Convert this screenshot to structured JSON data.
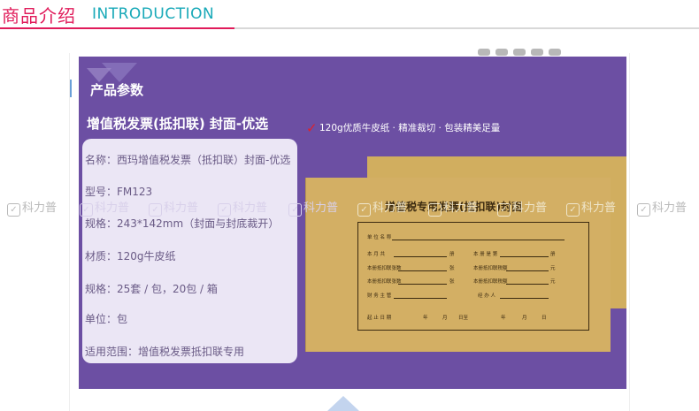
{
  "header": {
    "title_cn": "商品介绍",
    "title_en": "INTRODUCTION"
  },
  "panel": {
    "section_label": "产品参数",
    "title": "增值税发票(抵扣联) 封面-优选",
    "features": "120g优质牛皮纸 · 精准裁切 · 包装精美足量"
  },
  "specs": [
    "名称：西玛增值税发票（抵扣联）封面-优选",
    "型号：FM123",
    "规格：243*142mm（封面与封底裁开）",
    "材质：120g牛皮纸",
    "规格：25套 / 包，20包 / 箱",
    "单位：包",
    "适用范围：增值税发票抵扣联专用"
  ],
  "envelope": {
    "title": "增值税专用发票(抵扣联)封面",
    "fields": {
      "unit_name": "单 位 名 称",
      "period": "本    月    共",
      "page_count": "本 册 是 第",
      "amount": "本册抵扣联张数",
      "tax_amount": "本册抵扣联税额",
      "tax_total": "本册抵扣联税额",
      "supervisor": "财 务 主 管",
      "clerk": "经 办 人",
      "start_date": "起 止 日 期",
      "unit_ben": "册",
      "unit_zhang": "张",
      "unit_yuan": "元",
      "year": "年",
      "month": "月",
      "day": "日至",
      "year2": "年",
      "month2": "月",
      "day2": "日"
    }
  },
  "watermark": {
    "text": "科力普",
    "icon": "check-icon"
  }
}
